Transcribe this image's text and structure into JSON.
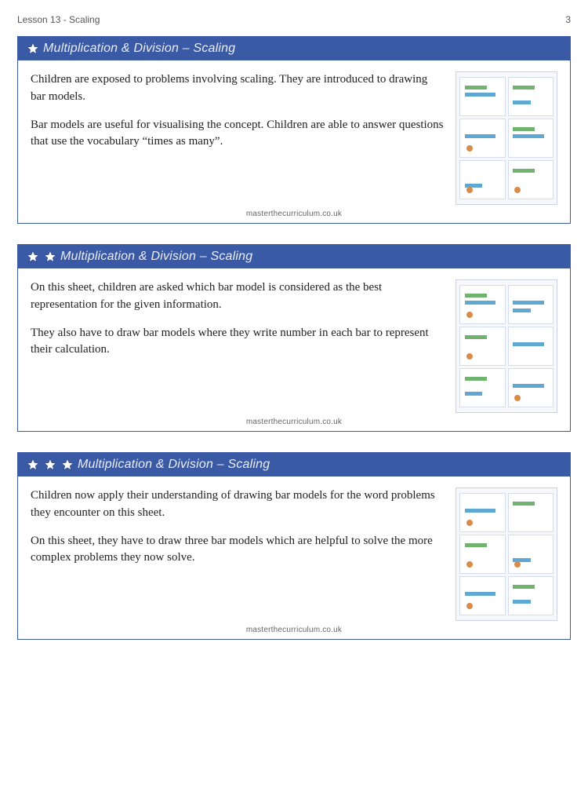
{
  "page": {
    "lesson_label": "Lesson 13  - Scaling",
    "page_number": "3"
  },
  "footer": "masterthecurriculum.co.uk",
  "cards": [
    {
      "stars": 1,
      "title": "Multiplication & Division – Scaling",
      "paragraphs": [
        "Children are exposed to problems involving scaling. They are introduced to drawing bar models.",
        "Bar models are useful for visualising the concept. Children are able to answer questions that use the vocabulary “times as many”."
      ]
    },
    {
      "stars": 2,
      "title": "Multiplication & Division – Scaling",
      "paragraphs": [
        "On this sheet, children are asked which bar model is considered as the best representation for the given information.",
        "They also have to draw bar models where they write number in each bar to represent their calculation."
      ]
    },
    {
      "stars": 3,
      "title": "Multiplication & Division – Scaling",
      "paragraphs": [
        "Children now apply their understanding of drawing bar models for the word problems they encounter on this sheet.",
        "On this sheet, they have to draw three bar models which are helpful to solve the more complex problems they now solve."
      ]
    }
  ]
}
